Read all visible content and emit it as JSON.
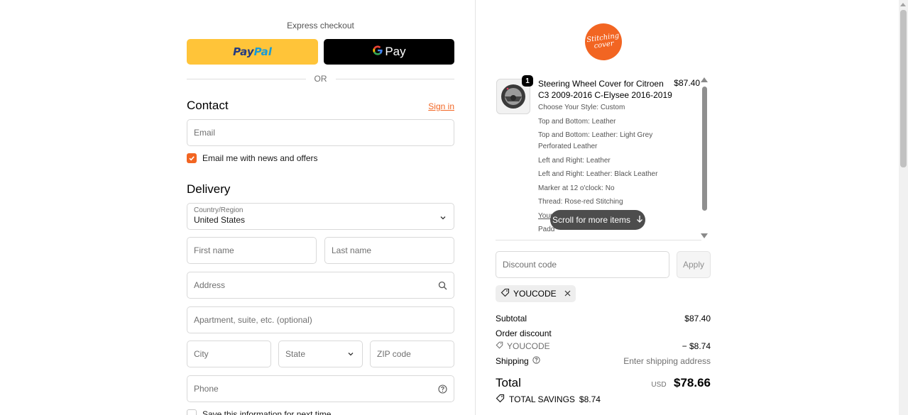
{
  "express": {
    "title": "Express checkout",
    "paypal_label_1": "Pay",
    "paypal_label_2": "Pal",
    "gpay_label": "Pay",
    "or_label": "OR"
  },
  "contact": {
    "title": "Contact",
    "signin_label": "Sign in",
    "email_placeholder": "Email",
    "news_label": "Email me with news and offers",
    "news_checked": true
  },
  "delivery": {
    "title": "Delivery",
    "country_label": "Country/Region",
    "country_value": "United States",
    "first_name_placeholder": "First name",
    "last_name_placeholder": "Last name",
    "address_placeholder": "Address",
    "apartment_placeholder": "Apartment, suite, etc. (optional)",
    "city_placeholder": "City",
    "state_placeholder": "State",
    "zip_placeholder": "ZIP code",
    "phone_placeholder": "Phone",
    "save_label": "Save this information for next time"
  },
  "store": {
    "logo_line1": "Stitching",
    "logo_line2": "cover",
    "brand_color": "#f26522"
  },
  "cart": {
    "item": {
      "quantity": "1",
      "title": "Steering Wheel Cover for Citroen C3 2009-2016 C-Elysee 2016-2019",
      "price": "$87.40",
      "options": [
        "Choose Your Style: Custom",
        "Top and Bottom: Leather",
        "Top and Bottom: Leather: Light Grey Perforated Leather",
        "Left and Right: Leather",
        "Left and Right: Leather: Black Leather",
        "Marker at 12 o'clock: No",
        "Thread: Rose-red Stitching",
        "Your",
        "Padd"
      ]
    },
    "scroll_hint": "Scroll for more items"
  },
  "discount": {
    "placeholder": "Discount code",
    "apply_label": "Apply",
    "applied_code": "YOUCODE"
  },
  "summary": {
    "subtotal_label": "Subtotal",
    "subtotal_value": "$87.40",
    "order_discount_label": "Order discount",
    "discount_code": "YOUCODE",
    "discount_value": "− $8.74",
    "shipping_label": "Shipping",
    "shipping_value": "Enter shipping address",
    "total_label": "Total",
    "currency": "USD",
    "total_value": "$78.66",
    "savings_label": "TOTAL SAVINGS",
    "savings_value": "$8.74"
  }
}
